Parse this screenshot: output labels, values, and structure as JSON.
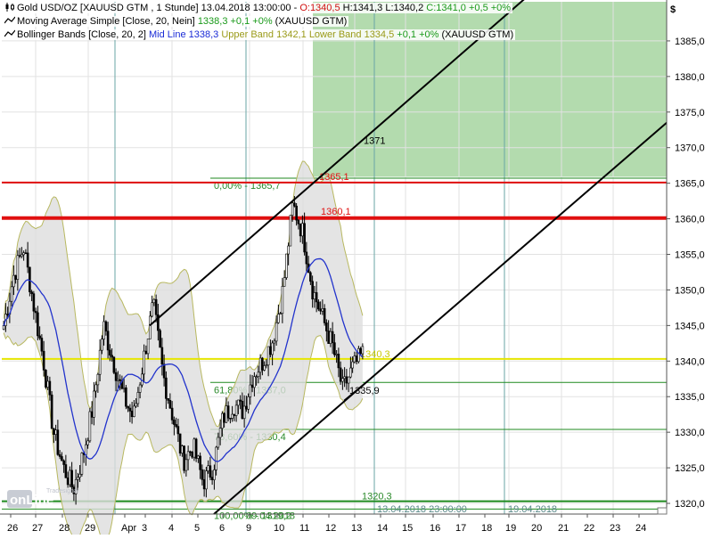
{
  "header": {
    "row1": {
      "name": "Gold USD/OZ [XAUUSD GTM , 1 Stunde] 13.04.2018 13:00:00 -",
      "open": "O:1340,5",
      "high": "H:1341,3",
      "low": "L:1340,2",
      "close": "C:1341,0 +0,5 +0%"
    },
    "row2": {
      "name": "Moving Average Simple [Close, 20, Nein]",
      "value": "1338,3 +0,1 +0%",
      "symbol": "(XAUUSD GTM)"
    },
    "row3": {
      "name": "Bollinger Bands [Close, 20, 2]",
      "mid": "Mid Line 1338,3",
      "upper": "Upper Band 1342,1",
      "lower": "Lower Band 1334,5",
      "change": "+0,1 +0%",
      "symbol": "(XAUUSD GTM)"
    }
  },
  "currency_symbol": "$",
  "watermark": {
    "brand": "onLine",
    "sub": "Tradesignal"
  },
  "colors": {
    "red_line": "#e01010",
    "yellow_line": "#e6e600",
    "green_line": "#1f8a1f",
    "target_box": "#a6d5a0",
    "ma": "#2233cc",
    "band_fill": "#dddddd",
    "band_line": "#b8b860",
    "channel": "#000000",
    "candle": "#000000"
  },
  "chart_data": {
    "type": "candlestick",
    "title": "Gold USD/OZ",
    "xlabel": "",
    "ylabel": "",
    "ylim": [
      1318.5,
      1390.5
    ],
    "y_ticks": [
      1320,
      1325,
      1330,
      1335,
      1340,
      1345,
      1350,
      1355,
      1360,
      1365,
      1370,
      1375,
      1380,
      1385
    ],
    "y_tick_labels": [
      "1320,0",
      "1325,0",
      "1330,0",
      "1335,0",
      "1340,0",
      "1345,0",
      "1350,0",
      "1355,0",
      "1360,0",
      "1365,0",
      "1370,0",
      "1375,0",
      "1380,0",
      "1385,0"
    ],
    "x_tick_labels": [
      "26",
      "27",
      "28",
      "29",
      "Apr",
      "3",
      "4",
      "5",
      "6",
      "9",
      "10",
      "11",
      "12",
      "13",
      "14",
      "15",
      "16",
      "17",
      "18",
      "19",
      "20",
      "21",
      "22",
      "23",
      "24"
    ],
    "x_marker_labels": [
      "13.04.2018 23:00:00",
      "19.04.2018"
    ],
    "grid": true,
    "series_ma": "Moving Average Simple [Close, 20, Nein]",
    "series_bands": "Bollinger Bands [Close, 20, 2]",
    "price_path": [
      [
        0,
        1345
      ],
      [
        1,
        1352
      ],
      [
        2,
        1356
      ],
      [
        3,
        1348
      ],
      [
        4,
        1340
      ],
      [
        5,
        1330
      ],
      [
        6,
        1325
      ],
      [
        7,
        1322
      ],
      [
        8,
        1327
      ],
      [
        9,
        1334
      ],
      [
        10,
        1345
      ],
      [
        11,
        1340
      ],
      [
        12,
        1335
      ],
      [
        13,
        1332
      ],
      [
        14,
        1340
      ],
      [
        15,
        1348
      ],
      [
        16,
        1338
      ],
      [
        17,
        1332
      ],
      [
        18,
        1326
      ],
      [
        19,
        1328
      ],
      [
        20,
        1323
      ],
      [
        21,
        1325
      ],
      [
        22,
        1332
      ],
      [
        23,
        1334
      ],
      [
        24,
        1333
      ],
      [
        25,
        1338
      ],
      [
        26,
        1340
      ],
      [
        27,
        1343
      ],
      [
        28,
        1350
      ],
      [
        29,
        1362
      ],
      [
        30,
        1358
      ],
      [
        31,
        1350
      ],
      [
        32,
        1346
      ],
      [
        33,
        1342
      ],
      [
        34,
        1336
      ],
      [
        35,
        1339
      ],
      [
        36,
        1341
      ]
    ],
    "annotations": {
      "resistance_1": {
        "value": 1365.1,
        "label": "1365,1"
      },
      "resistance_2": {
        "value": 1360.1,
        "label": "1360,1"
      },
      "current": {
        "value": 1340.3,
        "label": "1340,3"
      },
      "support": {
        "value": 1320.3,
        "label": "1320,3"
      },
      "channel_low": {
        "value": 1335.9,
        "label": "1335,9"
      },
      "target": {
        "value": 1371,
        "label": "1371"
      },
      "fib_0": {
        "value": 1365.7,
        "label": "0,00% - 1365,7"
      },
      "fib_618": {
        "value": 1337.0,
        "label": "61,80% - 1337,0"
      },
      "fib_786": {
        "value": 1330.4,
        "label": "78,60% - 1330,4"
      },
      "fib_100": {
        "value": 1319.2,
        "label": "100,00% - 1319,2"
      },
      "fib_date": {
        "label": "09.04.2018"
      }
    }
  }
}
